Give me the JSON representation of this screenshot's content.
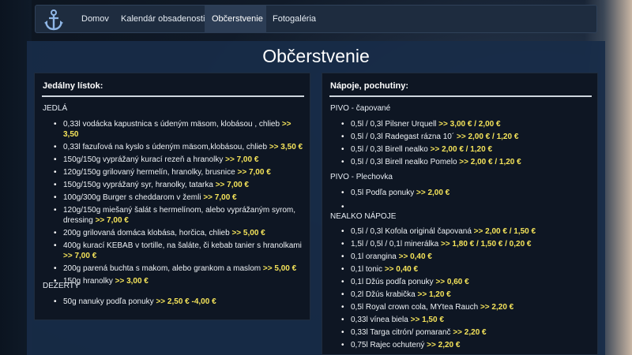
{
  "nav": {
    "items": [
      {
        "label": "Domov"
      },
      {
        "label": "Kalendár obsadenosti"
      },
      {
        "label": "Občerstvenie",
        "active": true
      },
      {
        "label": "Fotogaléria"
      }
    ],
    "logo_icon": "anchor-icon"
  },
  "page": {
    "title": "Občerstvenie"
  },
  "food": {
    "header": "Jedálny lístok:",
    "sections": [
      {
        "label": "JEDLÁ",
        "items": [
          {
            "text": "0,33l vodácka kapustnica s údeným mäsom, klobásou , chlieb ",
            "price": ">> 3,50"
          },
          {
            "text": "0,33l fazuľová na kyslo s údeným mäsom,klobásou,  chlieb ",
            "price": ">> 3,50 €"
          },
          {
            "text": "150g/150g vyprážaný kurací rezeň a hranolky ",
            "price": ">> 7,00 €"
          },
          {
            "text": "120g/150g grilovaný hermelín, hranolky, brusnice ",
            "price": ">> 7,00 €"
          },
          {
            "text": "150g/150g vyprážaný syr, hranolky, tatarka ",
            "price": ">> 7,00 €"
          },
          {
            "text": "100g/300g Burger s cheddarom v žemli ",
            "price": ">> 7,00 €"
          },
          {
            "text": "120g/150g miešaný šalát s hermelínom, alebo vyprážaným syrom, dressing ",
            "price": ">> 7,00 €"
          },
          {
            "text": "200g  grilovaná domáca klobása, horčica, chlieb ",
            "price": ">> 5,00 €"
          },
          {
            "text": "400g kurací KEBAB v tortille, na šaláte, či kebab tanier s hranolkami ",
            "price": ">> 7,00 €"
          },
          {
            "text": "200g parená buchta s makom, alebo grankom a maslom ",
            "price": ">> 5,00 €"
          },
          {
            "text": "150g hranolky  ",
            "price": ">> 3,00 €"
          }
        ]
      },
      {
        "label": "DEZERTY",
        "items": [
          {
            "text": "50g nanuky podľa ponuky ",
            "price": ">> 2,50 € -4,00 €"
          }
        ]
      }
    ]
  },
  "drinks": {
    "header": "Nápoje, pochutiny:",
    "sections": [
      {
        "label": "PIVO - čapované",
        "items": [
          {
            "text": "0,5l / 0,3l Pilsner Urquell ",
            "price": ">> 3,00 € / 2,00 €"
          },
          {
            "text": "0,5l / 0,3l Radegast rázna 10´ ",
            "price": ">> 2,00 € / 1,20 €"
          },
          {
            "text": "0,5l / 0,3l Birell nealko  ",
            "price": ">> 2,00 € / 1,20 €"
          },
          {
            "text": "0,5l / 0,3l Birell nealko Pomelo ",
            "price": ">> 2,00 € / 1,20 €"
          }
        ]
      },
      {
        "label": "PIVO - Plechovka",
        "items": [
          {
            "text": "0,5l Podľa ponuky ",
            "price": ">> 2,00 €"
          },
          {
            "text": "",
            "price": ""
          }
        ]
      },
      {
        "label": "NEALKO NÁPOJE",
        "items": [
          {
            "text": "0,5l / 0,3l Kofola originál čapovaná ",
            "price": ">> 2,00 € / 1,50 €"
          },
          {
            "text": "1,5l / 0,5l / 0,1l minerálka ",
            "price": ">> 1,80 € / 1,50 € / 0,20 €"
          },
          {
            "text": "0,1l orangina ",
            "price": ">> 0,40 €"
          },
          {
            "text": "0,1l tonic ",
            "price": ">> 0,40 €"
          },
          {
            "text": "0,1l Džús podľa ponuky ",
            "price": ">> 0,60 €"
          },
          {
            "text": "0,2l Džús krabička ",
            "price": ">> 1,20 €"
          },
          {
            "text": "0,5l Royal crown cola, MYtea Rauch ",
            "price": ">> 2,20 €"
          },
          {
            "text": "0,33l vínea biela ",
            "price": ">> 1,50 €"
          },
          {
            "text": "0,33l Targa citrón/ pomaranč  ",
            "price": ">> 2,20 €"
          },
          {
            "text": "0,75l Rajec ochutený ",
            "price": ">> 2,20 €"
          }
        ]
      }
    ]
  }
}
